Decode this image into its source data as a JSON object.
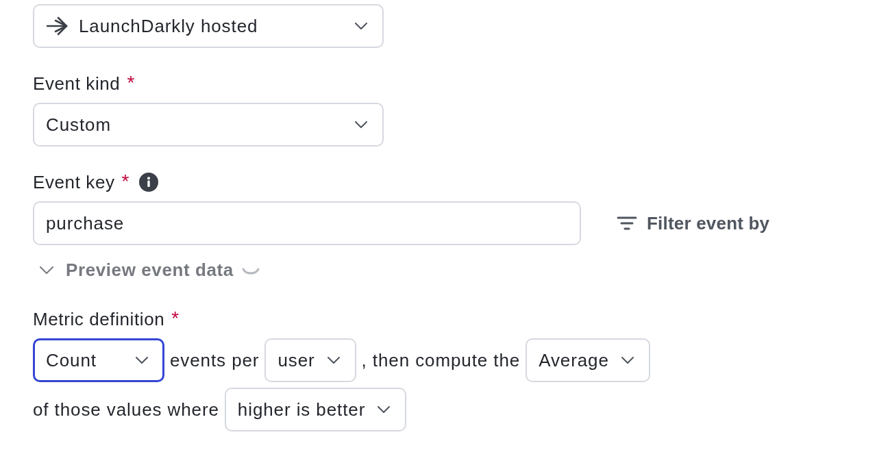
{
  "source_select": {
    "value": "LaunchDarkly hosted"
  },
  "event_kind": {
    "label": "Event kind",
    "required_mark": "*",
    "value": "Custom"
  },
  "event_key": {
    "label": "Event key",
    "required_mark": "*",
    "value": "purchase"
  },
  "filter_button": {
    "label": "Filter event by"
  },
  "preview_toggle": {
    "label": "Preview event data",
    "loading": true
  },
  "metric_definition": {
    "label": "Metric definition",
    "required_mark": "*",
    "lines": [
      [
        {
          "kind": "select",
          "value": "Count",
          "focused": true
        },
        {
          "kind": "text",
          "text": "events per"
        },
        {
          "kind": "select",
          "value": "user",
          "focused": false
        },
        {
          "kind": "text",
          "text": ", then compute the"
        },
        {
          "kind": "select",
          "value": "Average",
          "focused": false
        }
      ],
      [
        {
          "kind": "text",
          "text": "of those values where"
        },
        {
          "kind": "select",
          "value": "higher is better",
          "focused": false
        }
      ]
    ]
  }
}
